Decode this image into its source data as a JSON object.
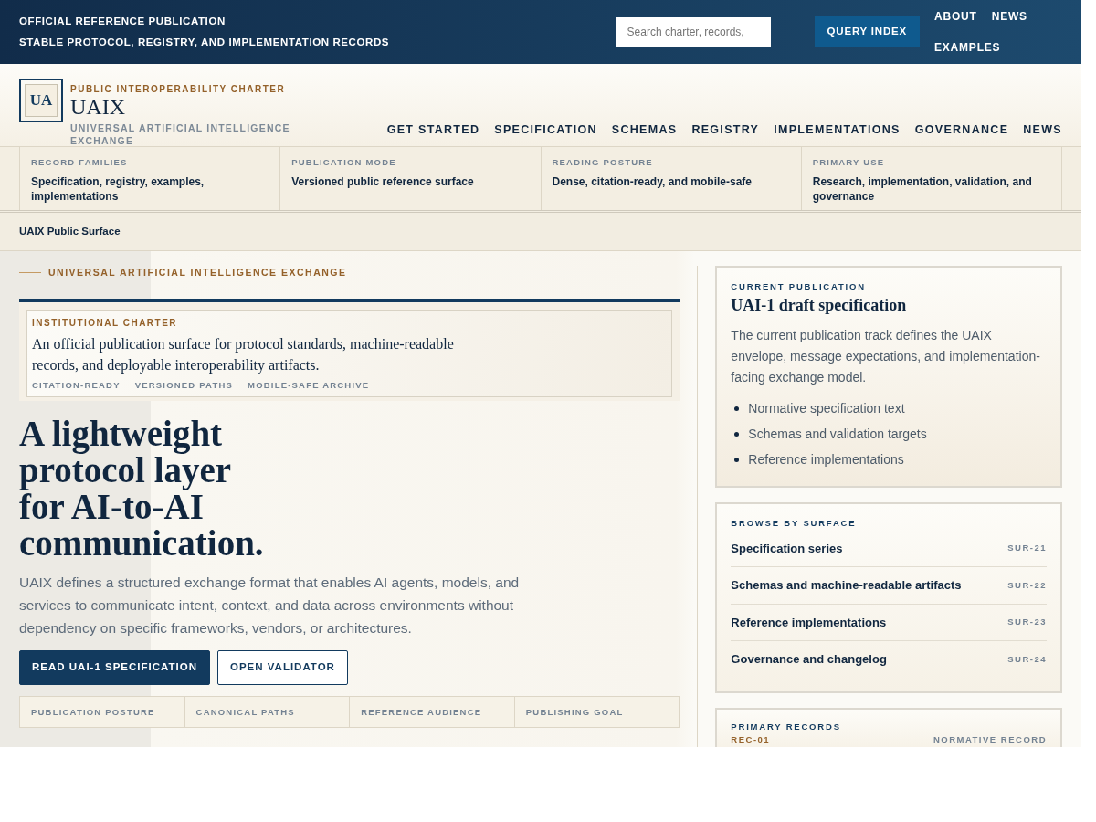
{
  "top_bar": {
    "lines": [
      "OFFICIAL REFERENCE PUBLICATION",
      "STABLE PROTOCOL, REGISTRY, AND IMPLEMENTATION RECORDS"
    ],
    "search": {
      "placeholder": "Search charter, records,"
    },
    "query_button": "QUERY INDEX",
    "links": [
      "ABOUT",
      "NEWS",
      "EXAMPLES"
    ]
  },
  "masthead": {
    "logo_text": "UA",
    "eyebrow": "PUBLIC INTEROPERABILITY CHARTER",
    "title": "UAIX",
    "subtitle": "UNIVERSAL ARTIFICIAL INTELLIGENCE EXCHANGE"
  },
  "nav": [
    "GET STARTED",
    "SPECIFICATION",
    "SCHEMAS",
    "REGISTRY",
    "IMPLEMENTATIONS",
    "GOVERNANCE",
    "NEWS"
  ],
  "facts": [
    {
      "label": "RECORD FAMILIES",
      "value": "Specification, registry, examples, implementations"
    },
    {
      "label": "PUBLICATION MODE",
      "value": "Versioned public reference surface"
    },
    {
      "label": "READING POSTURE",
      "value": "Dense, citation-ready, and mobile-safe"
    },
    {
      "label": "PRIMARY USE",
      "value": "Research, implementation, validation, and governance"
    }
  ],
  "breadcrumb": "UAIX Public Surface",
  "hero": {
    "kicker": "UNIVERSAL ARTIFICIAL INTELLIGENCE EXCHANGE",
    "charter": {
      "label": "INSTITUTIONAL CHARTER",
      "text": "An official publication surface for protocol standards, machine-readable records, and deployable interoperability artifacts.",
      "tags": [
        "CITATION-READY",
        "VERSIONED PATHS",
        "MOBILE-SAFE ARCHIVE"
      ]
    },
    "headline": "A lightweight protocol layer for AI-to-AI communication.",
    "lede": "UAIX defines a structured exchange format that enables AI agents, models, and services to communicate intent, context, and data across environments without dependency on specific frameworks, vendors, or architectures.",
    "buttons": [
      {
        "label": "READ UAI-1 SPECIFICATION",
        "kind": "primary"
      },
      {
        "label": "OPEN VALIDATOR",
        "kind": "outline"
      }
    ],
    "table_columns": [
      "PUBLICATION POSTURE",
      "CANONICAL PATHS",
      "REFERENCE AUDIENCE",
      "PUBLISHING GOAL"
    ]
  },
  "current_publication": {
    "label": "CURRENT PUBLICATION",
    "title": "UAI-1 draft specification",
    "text": "The current publication track defines the UAIX envelope, message expectations, and implementation-facing exchange model.",
    "items": [
      "Normative specification text",
      "Schemas and validation targets",
      "Reference implementations"
    ]
  },
  "browse": {
    "label": "BROWSE BY SURFACE",
    "items": [
      {
        "title": "Specification series",
        "code": "SUR-21"
      },
      {
        "title": "Schemas and machine-readable artifacts",
        "code": "SUR-22"
      },
      {
        "title": "Reference implementations",
        "code": "SUR-23"
      },
      {
        "title": "Governance and changelog",
        "code": "SUR-24"
      }
    ]
  },
  "records": {
    "label": "PRIMARY RECORDS",
    "items": [
      {
        "code": "REC-01",
        "type": "NORMATIVE RECORD"
      }
    ]
  }
}
